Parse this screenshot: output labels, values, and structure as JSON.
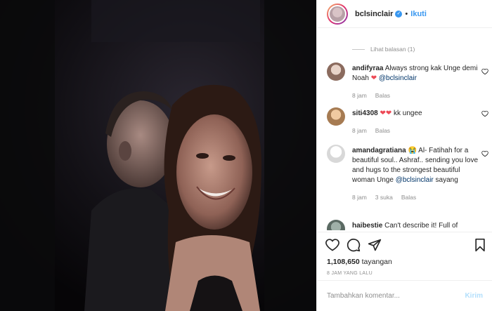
{
  "header": {
    "username": "bclsinclair",
    "verified_mark": "✓",
    "separator": "•",
    "follow_label": "Ikuti"
  },
  "comments": {
    "view_replies_label": "Lihat balasan (1)",
    "items": [
      {
        "username": "andifyraa",
        "text_before": " Always strong kak Unge demi Noah ",
        "emoji": "❤",
        "mention": "@bclsinclair",
        "text_after": "",
        "time": "8 jam",
        "likes": "",
        "reply_label": "Balas"
      },
      {
        "username": "siti4308",
        "text_before": " ",
        "emoji": "❤❤",
        "mention": "",
        "text_after": "kk ungee",
        "time": "8 jam",
        "likes": "",
        "reply_label": "Balas"
      },
      {
        "username": "amandagratiana",
        "text_before": " 😭 Al- Fatihah for a beautiful soul.. Ashraf.. sending you love and hugs to the strongest beautiful woman Unge ",
        "emoji": "",
        "mention": "@bclsinclair",
        "text_after": " sayang",
        "time": "8 jam",
        "likes": "3 suka",
        "reply_label": "Balas"
      },
      {
        "username": "haibestie",
        "text_before": " Can't describe it! Full of",
        "emoji": "",
        "mention": "",
        "text_after": "",
        "time": "",
        "likes": "",
        "reply_label": ""
      }
    ]
  },
  "actions": {
    "views_count": "1,108,650",
    "views_label": "tayangan",
    "timestamp": "8 JAM YANG LALU"
  },
  "add_comment": {
    "placeholder": "Tambahkan komentar...",
    "post_label": "Kirim"
  },
  "colors": {
    "link_blue": "#3897f0",
    "heart_red": "#ed4956",
    "muted_gray": "#8e8e8e",
    "post_disabled": "#b2dffc"
  }
}
